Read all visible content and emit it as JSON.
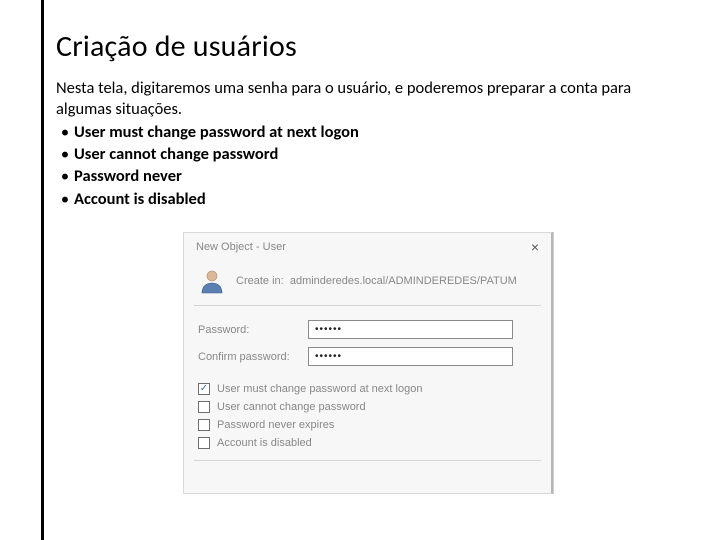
{
  "slide": {
    "title": "Criação de usuários",
    "intro": "Nesta tela, digitaremos uma senha para o usuário, e poderemos preparar a conta para algumas situações.",
    "bullets": [
      "User must change password at next logon",
      "User cannot change password",
      "Password never",
      "Account is disabled"
    ]
  },
  "dialog": {
    "title": "New Object - User",
    "close": "×",
    "create_in_label": "Create in:",
    "create_in_path": "adminderedes.local/ADMINDEREDES/PATUM",
    "password_label": "Password:",
    "password_value": "••••••",
    "confirm_label": "Confirm password:",
    "confirm_value": "••••••",
    "check_marks": {
      "on": "✓",
      "off": ""
    },
    "checks": [
      {
        "checked": true,
        "label": "User must change password at next logon"
      },
      {
        "checked": false,
        "label": "User cannot change password"
      },
      {
        "checked": false,
        "label": "Password never expires"
      },
      {
        "checked": false,
        "label": "Account is disabled"
      }
    ]
  }
}
